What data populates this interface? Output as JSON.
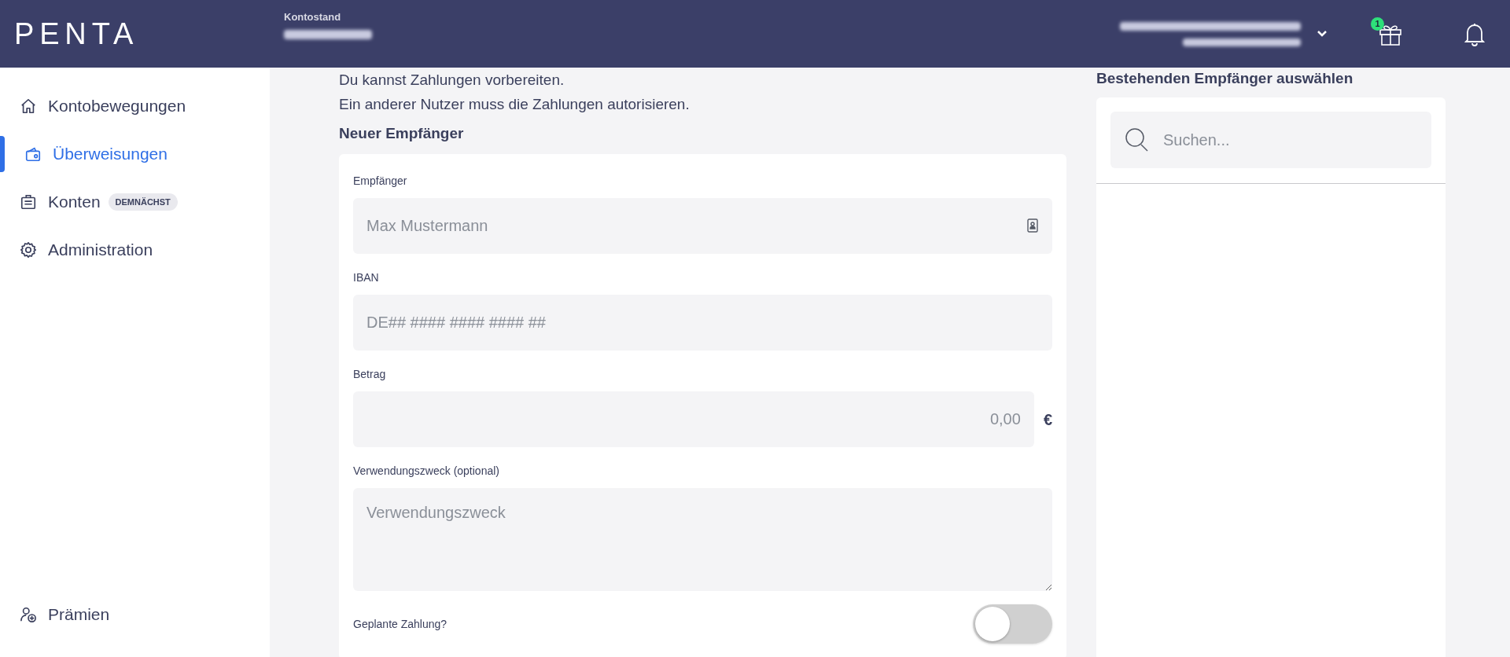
{
  "header": {
    "logo": "PENTA",
    "balance_label": "Kontostand",
    "gift_badge": "1"
  },
  "sidebar": {
    "items": [
      {
        "label": "Kontobewegungen",
        "selected": false
      },
      {
        "label": "Überweisungen",
        "selected": true
      },
      {
        "label": "Konten",
        "selected": false,
        "badge": "DEMNÄCHST"
      },
      {
        "label": "Administration",
        "selected": false
      }
    ],
    "bottom_items": [
      {
        "label": "Prämien",
        "selected": false
      }
    ]
  },
  "intro": [
    "Du kannst Zahlungen vorbereiten.",
    "Ein anderer Nutzer muss die Zahlungen autorisieren."
  ],
  "form": {
    "title": "Neuer Empfänger",
    "fields": [
      {
        "kind": "contact",
        "label": "Empfänger",
        "placeholder": "Max Mustermann"
      },
      {
        "kind": "text",
        "label": "IBAN",
        "placeholder": "DE## #### #### #### ##"
      },
      {
        "kind": "amount",
        "label": "Betrag",
        "placeholder": "0,00",
        "suffix": "€"
      },
      {
        "kind": "textarea",
        "label": "Verwendungszweck (optional)",
        "placeholder": "Verwendungszweck"
      }
    ],
    "toggle": {
      "label": "Geplante Zahlung?",
      "on": false
    }
  },
  "recipients": {
    "title": "Bestehenden Empfänger auswählen",
    "search": {
      "placeholder": "Suchen..."
    }
  }
}
